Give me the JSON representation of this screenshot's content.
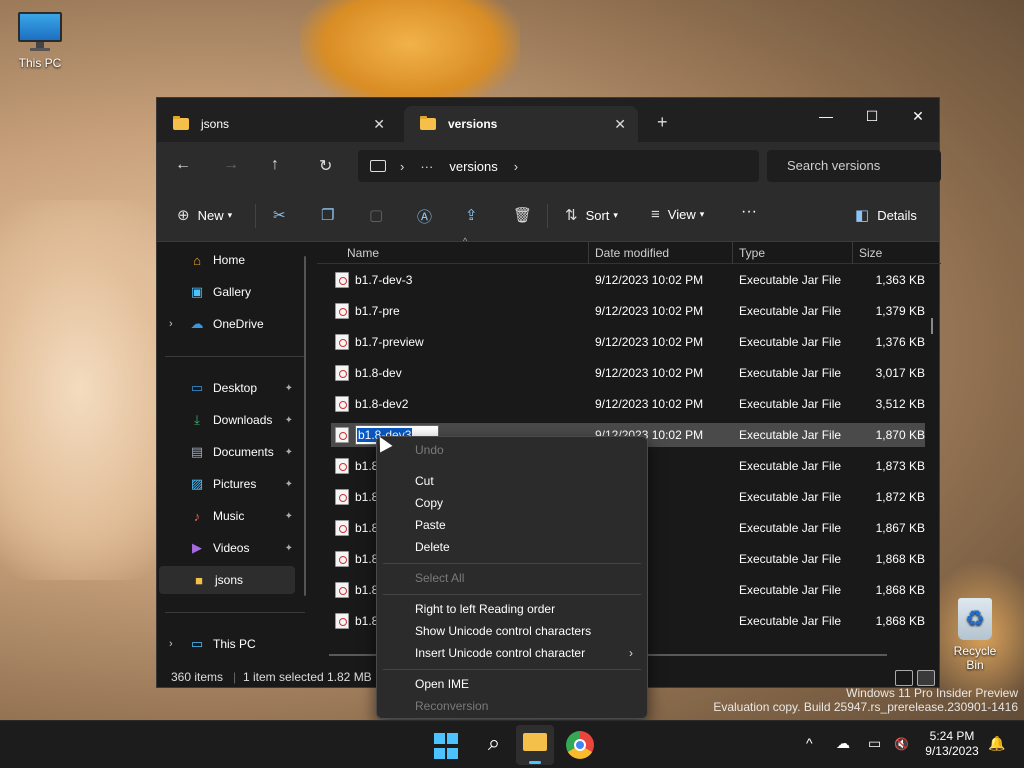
{
  "desktop": {
    "icons": [
      {
        "label": "This PC",
        "icon": "this-pc-icon"
      },
      {
        "label": "Recycle Bin",
        "icon": "recycle-bin-icon"
      }
    ],
    "watermark_line1": "Windows 11 Pro Insider Preview",
    "watermark_line2": "Evaluation copy. Build 25947.rs_prerelease.230901-1416"
  },
  "explorer": {
    "tabs": [
      {
        "label": "jsons",
        "active": false
      },
      {
        "label": "versions",
        "active": true
      }
    ],
    "new_tab_glyph": "+",
    "window_controls": {
      "minimize": "—",
      "maximize": "☐",
      "close": "✕"
    },
    "address": {
      "ellipsis": "···",
      "current": "versions",
      "search_placeholder": "Search versions"
    },
    "nav_glyphs": {
      "back": "←",
      "forward": "→",
      "up": "↑",
      "refresh": "↻"
    },
    "toolbar": {
      "new_label": "New",
      "sort_label": "Sort",
      "view_label": "View",
      "more": "···",
      "details_label": "Details"
    },
    "sidebar": {
      "items": [
        {
          "label": "Home",
          "icon": "home-icon",
          "glyph": "⌂",
          "color": "#f5a623"
        },
        {
          "label": "Gallery",
          "icon": "gallery-icon",
          "glyph": "▣",
          "color": "#4cc2ff"
        },
        {
          "label": "OneDrive",
          "icon": "onedrive-icon",
          "glyph": "☁",
          "color": "#3a96dd"
        },
        {
          "label": "Desktop",
          "icon": "desktop-icon",
          "glyph": "▭",
          "color": "#3a96dd"
        },
        {
          "label": "Downloads",
          "icon": "downloads-icon",
          "glyph": "⤓",
          "color": "#3cb371"
        },
        {
          "label": "Documents",
          "icon": "documents-icon",
          "glyph": "▤",
          "color": "#9aa8b8"
        },
        {
          "label": "Pictures",
          "icon": "pictures-icon",
          "glyph": "▨",
          "color": "#4cc2ff"
        },
        {
          "label": "Music",
          "icon": "music-icon",
          "glyph": "♪",
          "color": "#e8615a"
        },
        {
          "label": "Videos",
          "icon": "videos-icon",
          "glyph": "▶",
          "color": "#a66be0"
        },
        {
          "label": "jsons",
          "icon": "folder-icon",
          "glyph": "■",
          "color": "#f5c04a"
        },
        {
          "label": "This PC",
          "icon": "this-pc-icon",
          "glyph": "▭",
          "color": "#4cc2ff"
        }
      ],
      "pin_glyph": "📌"
    },
    "columns": [
      "Name",
      "Date modified",
      "Type",
      "Size"
    ],
    "rows": [
      {
        "name": "b1.7-dev-3",
        "date": "9/12/2023 10:02 PM",
        "type": "Executable Jar File",
        "size": "1,363 KB"
      },
      {
        "name": "b1.7-pre",
        "date": "9/12/2023 10:02 PM",
        "type": "Executable Jar File",
        "size": "1,379 KB"
      },
      {
        "name": "b1.7-preview",
        "date": "9/12/2023 10:02 PM",
        "type": "Executable Jar File",
        "size": "1,376 KB"
      },
      {
        "name": "b1.8-dev",
        "date": "9/12/2023 10:02 PM",
        "type": "Executable Jar File",
        "size": "3,017 KB"
      },
      {
        "name": "b1.8-dev2",
        "date": "9/12/2023 10:02 PM",
        "type": "Executable Jar File",
        "size": "3,512 KB"
      },
      {
        "name": "b1.8-dev3",
        "date": "9/12/2023 10:02 PM",
        "type": "Executable Jar File",
        "size": "1,870 KB"
      },
      {
        "name": "b1.8",
        "date": "",
        "type": "Executable Jar File",
        "size": "1,873 KB"
      },
      {
        "name": "b1.8",
        "date": "",
        "type": "Executable Jar File",
        "size": "1,872 KB"
      },
      {
        "name": "b1.8",
        "date": "",
        "type": "Executable Jar File",
        "size": "1,867 KB"
      },
      {
        "name": "b1.8",
        "date": "",
        "type": "Executable Jar File",
        "size": "1,868 KB"
      },
      {
        "name": "b1.8",
        "date": "",
        "type": "Executable Jar File",
        "size": "1,868 KB"
      },
      {
        "name": "b1.8",
        "date": "",
        "type": "Executable Jar File",
        "size": "1,868 KB"
      }
    ],
    "status": {
      "count": "360 items",
      "selected": "1 item selected",
      "size": "1.82 MB"
    }
  },
  "context_menu": {
    "items": [
      {
        "label": "Undo",
        "disabled": true
      },
      {
        "label": "Cut",
        "disabled": false
      },
      {
        "label": "Copy",
        "disabled": false
      },
      {
        "label": "Paste",
        "disabled": false
      },
      {
        "label": "Delete",
        "disabled": false
      },
      {
        "label": "Select All",
        "disabled": true
      },
      {
        "label": "Right to left Reading order",
        "disabled": false
      },
      {
        "label": "Show Unicode control characters",
        "disabled": false
      },
      {
        "label": "Insert Unicode control character",
        "disabled": false,
        "submenu": true
      },
      {
        "label": "Open IME",
        "disabled": false
      },
      {
        "label": "Reconversion",
        "disabled": true
      }
    ],
    "submenu_glyph": "›"
  },
  "taskbar": {
    "time": "5:24 PM",
    "date": "9/13/2023",
    "tray_glyphs": {
      "chevron": "^",
      "cloud": "☁",
      "network": "▭",
      "volume": "🔇",
      "notification": "🔔"
    }
  }
}
